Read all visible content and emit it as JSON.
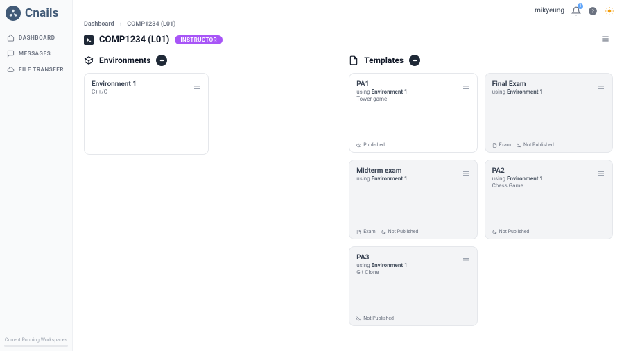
{
  "brand": "Cnails",
  "user": {
    "name": "mikyeung",
    "notification_count": "1"
  },
  "sidebar": {
    "items": [
      {
        "label": "DASHBOARD"
      },
      {
        "label": "MESSAGES"
      },
      {
        "label": "FILE TRANSFER"
      }
    ],
    "footer_label": "Current Running Workspaces"
  },
  "breadcrumb": {
    "items": [
      {
        "label": "Dashboard"
      },
      {
        "label": "COMP1234 (L01)"
      }
    ],
    "sep": "›"
  },
  "page": {
    "title": "COMP1234 (L01)",
    "role": "INSTRUCTOR"
  },
  "sections": {
    "environments": {
      "heading": "Environments",
      "cards": [
        {
          "title": "Environment 1",
          "subtitle": "C++/C"
        }
      ]
    },
    "templates": {
      "heading": "Templates",
      "using_prefix": "using "
    }
  },
  "templates": [
    {
      "title": "PA1",
      "env": "Environment 1",
      "desc": "Tower game",
      "bg": "white",
      "tags": [
        {
          "icon": "eye",
          "label": "Published"
        }
      ]
    },
    {
      "title": "Final Exam",
      "env": "Environment 1",
      "desc": "",
      "bg": "gray",
      "tags": [
        {
          "icon": "doc",
          "label": "Exam"
        },
        {
          "icon": "eye-off",
          "label": "Not Published"
        }
      ]
    },
    {
      "title": "Midterm exam",
      "env": "Environment 1",
      "desc": "",
      "bg": "gray",
      "tags": [
        {
          "icon": "doc",
          "label": "Exam"
        },
        {
          "icon": "eye-off",
          "label": "Not Published"
        }
      ]
    },
    {
      "title": "PA2",
      "env": "Environment 1",
      "desc": "Chess Game",
      "bg": "gray",
      "tags": [
        {
          "icon": "eye-off",
          "label": "Not Published"
        }
      ]
    },
    {
      "title": "PA3",
      "env": "Environment 1",
      "desc": "Git Clone",
      "bg": "gray",
      "tags": [
        {
          "icon": "eye-off",
          "label": "Not Published"
        }
      ]
    }
  ]
}
